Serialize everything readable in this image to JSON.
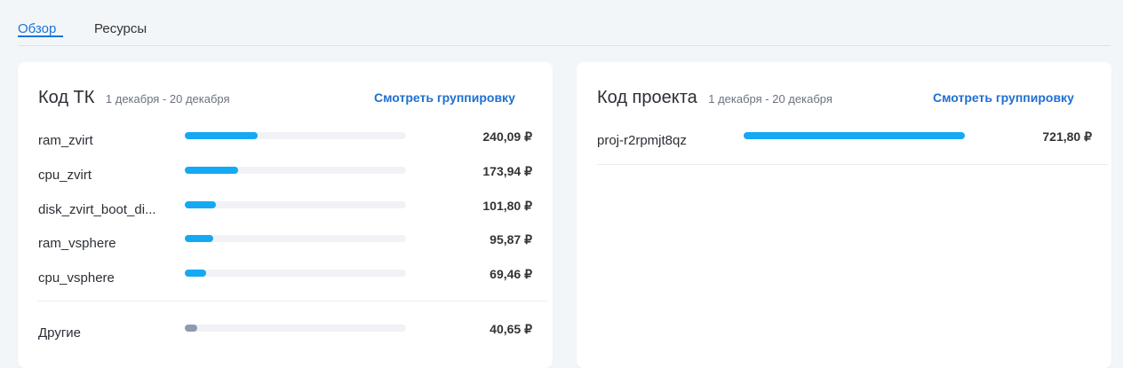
{
  "tabs": [
    {
      "label": "Обзор",
      "active": true
    },
    {
      "label": "Ресурсы",
      "active": false
    }
  ],
  "left_card": {
    "title": "Код ТК",
    "date_range": "1 декабря - 20 декабря",
    "link": "Смотреть группировку",
    "rows": [
      {
        "label": "ram_zvirt",
        "value": "240,09 ₽",
        "fraction": 0.33
      },
      {
        "label": "cpu_zvirt",
        "value": "173,94 ₽",
        "fraction": 0.24
      },
      {
        "label": "disk_zvirt_boot_di...",
        "value": "101,80 ₽",
        "fraction": 0.14
      },
      {
        "label": "ram_vsphere",
        "value": "95,87 ₽",
        "fraction": 0.13
      },
      {
        "label": "cpu_vsphere",
        "value": "69,46 ₽",
        "fraction": 0.095
      }
    ],
    "other": {
      "label": "Другие",
      "value": "40,65 ₽",
      "fraction": 0.056
    }
  },
  "right_card": {
    "title": "Код проекта",
    "date_range": "1 декабря - 20 декабря",
    "link": "Смотреть группировку",
    "rows": [
      {
        "label": "proj-r2rpmjt8qz",
        "value": "721,80 ₽",
        "fraction": 1.0
      }
    ]
  },
  "colors": {
    "accent": "#1a73d9",
    "bar": "#14a9f2",
    "bar_other": "#8e9aaf"
  }
}
